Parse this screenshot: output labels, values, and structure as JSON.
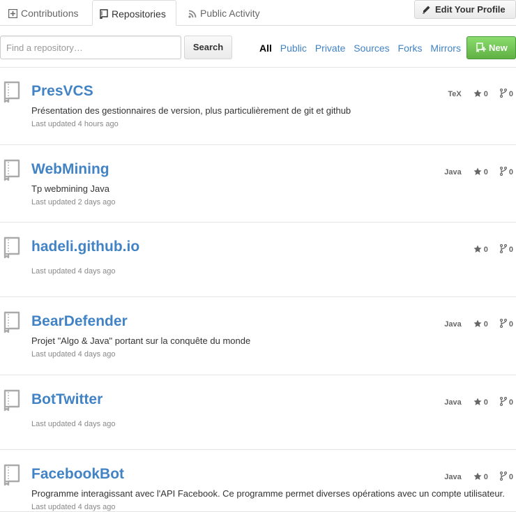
{
  "tabs": {
    "contributions": "Contributions",
    "repositories": "Repositories",
    "public_activity": "Public Activity"
  },
  "profile": {
    "edit_label": "Edit Your Profile"
  },
  "search": {
    "placeholder": "Find a repository…",
    "button": "Search"
  },
  "filters": [
    "All",
    "Public",
    "Private",
    "Sources",
    "Forks",
    "Mirrors"
  ],
  "filter_selected": "All",
  "new_button": "New",
  "colors": {
    "link": "#4183c4",
    "new_button": "#60b044",
    "border": "#e5e5e5"
  },
  "repos": [
    {
      "name": "PresVCS",
      "language": "TeX",
      "stars": "0",
      "forks": "0",
      "description": "Présentation des gestionnaires de version, plus particulièrement de git et github",
      "updated": "Last updated 4 hours ago"
    },
    {
      "name": "WebMining",
      "language": "Java",
      "stars": "0",
      "forks": "0",
      "description": "Tp webmining Java",
      "updated": "Last updated 2 days ago"
    },
    {
      "name": "hadeli.github.io",
      "language": "",
      "stars": "0",
      "forks": "0",
      "description": "",
      "updated": "Last updated 4 days ago"
    },
    {
      "name": "BearDefender",
      "language": "Java",
      "stars": "0",
      "forks": "0",
      "description": "Projet \"Algo & Java\" portant sur la conquête du monde",
      "updated": "Last updated 4 days ago"
    },
    {
      "name": "BotTwitter",
      "language": "Java",
      "stars": "0",
      "forks": "0",
      "description": "",
      "updated": "Last updated 4 days ago"
    },
    {
      "name": "FacebookBot",
      "language": "Java",
      "stars": "0",
      "forks": "0",
      "description": "Programme interagissant avec l'API Facebook. Ce programme permet diverses opérations avec un compte utilisateur.",
      "updated": "Last updated 4 days ago"
    }
  ]
}
